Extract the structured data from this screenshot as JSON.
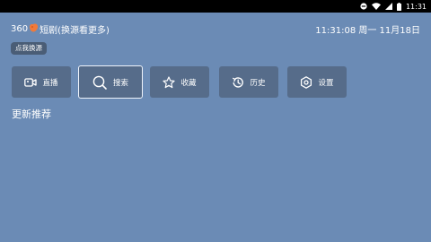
{
  "status_bar": {
    "time": "11:31",
    "icons": [
      "do-not-disturb-icon",
      "wifi-icon",
      "signal-icon",
      "battery-icon"
    ]
  },
  "header": {
    "title_prefix": "360",
    "logo_icon": "shortplay-logo-icon",
    "title_suffix": "短剧(换源看更多)",
    "datetime": "11:31:08 周一 11月18日"
  },
  "switch_source_label": "点我换源",
  "nav": [
    {
      "id": "live",
      "label": "直播",
      "icon": "video-camera-icon",
      "focused": false
    },
    {
      "id": "search",
      "label": "搜索",
      "icon": "search-icon",
      "focused": true
    },
    {
      "id": "favorites",
      "label": "收藏",
      "icon": "star-icon",
      "focused": false
    },
    {
      "id": "history",
      "label": "历史",
      "icon": "history-icon",
      "focused": false
    },
    {
      "id": "settings",
      "label": "设置",
      "icon": "settings-icon",
      "focused": false
    }
  ],
  "section": {
    "title": "更新推荐"
  },
  "colors": {
    "background": "#6b8bb5",
    "nav_item": "#566c8a",
    "switch_button": "#4a5d76",
    "logo_accent": "#f07a3a",
    "status_bar": "#000000"
  }
}
